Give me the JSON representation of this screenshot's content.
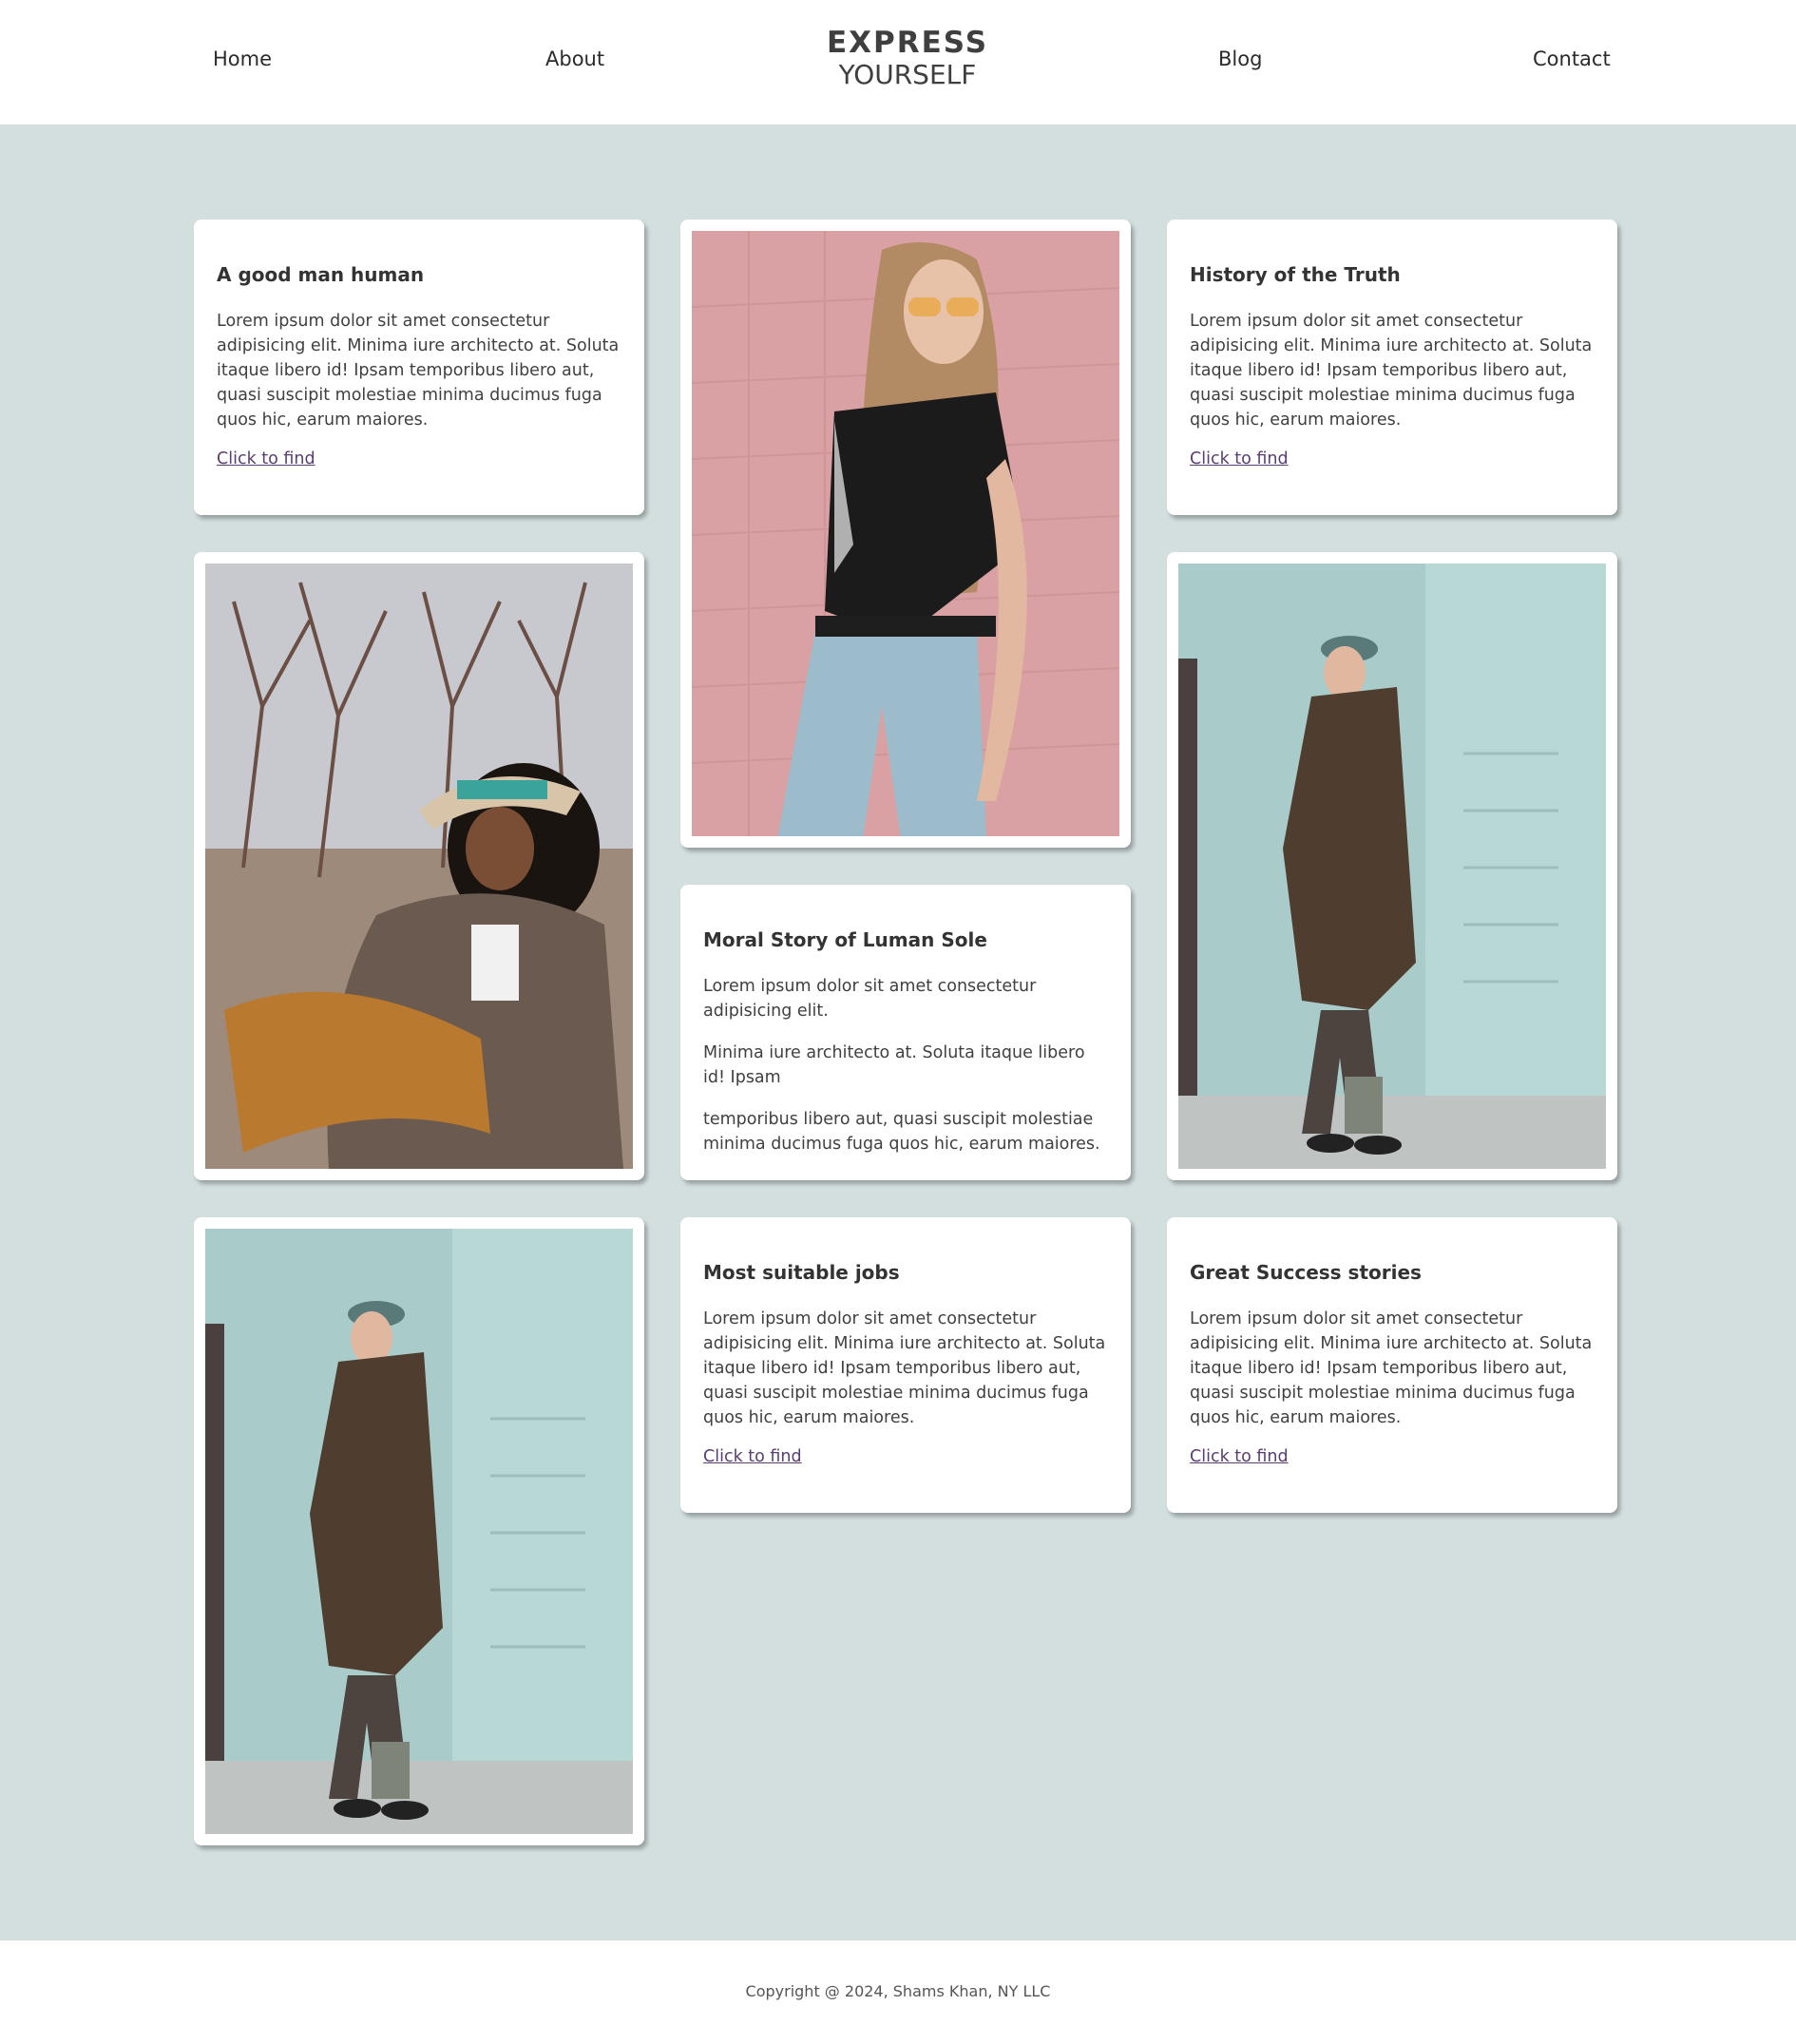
{
  "header": {
    "nav": {
      "home": "Home",
      "about": "About",
      "blog": "Blog",
      "contact": "Contact"
    },
    "logo": {
      "line1": "EXPRESS",
      "line2": "YOURSELF"
    }
  },
  "cards": {
    "good_man": {
      "title": "A good man human",
      "body": "Lorem ipsum dolor sit amet consectetur adipisicing elit. Minima iure architecto at. Soluta itaque libero id! Ipsam temporibus libero aut, quasi suscipit molestiae minima ducimus fuga quos hic, earum maiores.",
      "link": "Click to find"
    },
    "history": {
      "title": "History of the Truth",
      "body": "Lorem ipsum dolor sit amet consectetur adipisicing elit. Minima iure architecto at. Soluta itaque libero id! Ipsam temporibus libero aut, quasi suscipit molestiae minima ducimus fuga quos hic, earum maiores.",
      "link": "Click to find"
    },
    "moral": {
      "title": "Moral Story of Luman Sole",
      "p1": "Lorem ipsum dolor sit amet consectetur adipisicing elit.",
      "p2": "Minima iure architecto at. Soluta itaque libero id! Ipsam",
      "p3": "temporibus libero aut, quasi suscipit molestiae minima ducimus fuga quos hic, earum maiores."
    },
    "jobs": {
      "title": "Most suitable jobs",
      "body": "Lorem ipsum dolor sit amet consectetur adipisicing elit. Minima iure architecto at. Soluta itaque libero id! Ipsam temporibus libero aut, quasi suscipit molestiae minima ducimus fuga quos hic, earum maiores.",
      "link": "Click to find"
    },
    "success": {
      "title": "Great Success stories",
      "body": "Lorem ipsum dolor sit amet consectetur adipisicing elit. Minima iure architecto at. Soluta itaque libero id! Ipsam temporibus libero aut, quasi suscipit molestiae minima ducimus fuga quos hic, earum maiores.",
      "link": "Click to find"
    }
  },
  "footer": {
    "copyright": "Copyright @ 2024, Shams Khan, NY LLC"
  },
  "colors": {
    "main_bg": "#d3dedf",
    "card_bg": "#ffffff",
    "link": "#5a3d70",
    "text": "#404040"
  }
}
